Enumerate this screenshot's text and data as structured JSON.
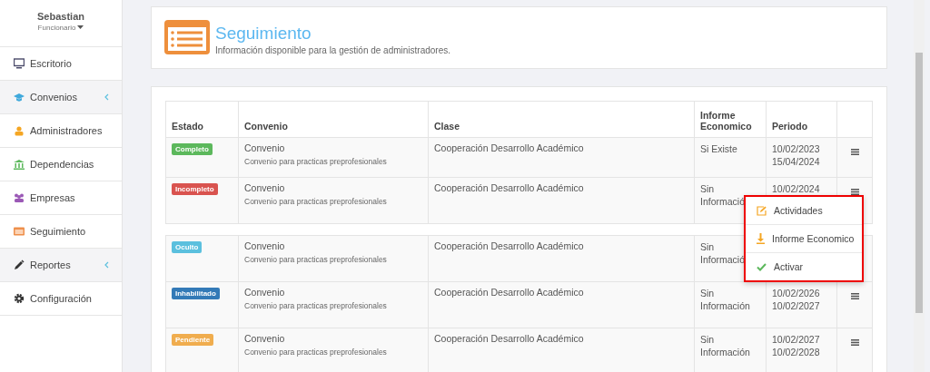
{
  "user": {
    "name": "Sebastian",
    "role": "Funcionario"
  },
  "sidebar": {
    "items": [
      {
        "label": "Escritorio",
        "expandable": false
      },
      {
        "label": "Convenios",
        "expandable": true
      },
      {
        "label": "Administradores",
        "expandable": false
      },
      {
        "label": "Dependencias",
        "expandable": false
      },
      {
        "label": "Empresas",
        "expandable": false
      },
      {
        "label": "Seguimiento",
        "expandable": false
      },
      {
        "label": "Reportes",
        "expandable": true
      },
      {
        "label": "Configuración",
        "expandable": false
      }
    ]
  },
  "header": {
    "title": "Seguimiento",
    "subtitle": "Información disponible para la gestión de administradores."
  },
  "table": {
    "columns": [
      "Estado",
      "Convenio",
      "Clase",
      "Informe Economico",
      "Periodo"
    ],
    "rows": [
      {
        "status": "Completo",
        "color": "#5cb85c",
        "convenio": "Convenio",
        "detail": "Convenio para practicas preprofesionales",
        "clase": "Cooperación Desarrollo Académico",
        "informe": [
          "Si Existe"
        ],
        "periodo": [
          "10/02/2023",
          "15/04/2024"
        ]
      },
      {
        "status": "Incompleto",
        "color": "#d9534f",
        "convenio": "Convenio",
        "detail": "Convenio para practicas preprofesionales",
        "clase": "Cooperación Desarrollo Académico",
        "informe": [
          "Sin",
          "Informació"
        ],
        "periodo": [
          "10/02/2024"
        ]
      },
      {
        "status": "Oculto",
        "color": "#5bc0de",
        "convenio": "Convenio",
        "detail": "Convenio para practicas preprofesionales",
        "clase": "Cooperación Desarrollo Académico",
        "informe": [
          "Sin",
          "Informació"
        ]
      },
      {
        "status": "Inhabilitado",
        "color": "#337ab7",
        "convenio": "Convenio",
        "detail": "Convenio para practicas preprofesionales",
        "clase": "Cooperación Desarrollo Académico",
        "informe": [
          "Sin",
          "Información"
        ],
        "periodo": [
          "10/02/2026",
          "10/02/2027"
        ]
      },
      {
        "status": "Pendiente",
        "color": "#f0ad4e",
        "convenio": "Convenio",
        "detail": "Convenio para practicas preprofesionales",
        "clase": "Cooperación Desarrollo Académico",
        "informe": [
          "Sin",
          "Información"
        ],
        "periodo": [
          "10/02/2027",
          "10/02/2028"
        ]
      }
    ]
  },
  "dropdown": {
    "items": [
      {
        "label": "Actividades",
        "kind": "edit"
      },
      {
        "label": "Informe Economico",
        "kind": "download"
      },
      {
        "label": "Activar",
        "kind": "check"
      }
    ]
  }
}
